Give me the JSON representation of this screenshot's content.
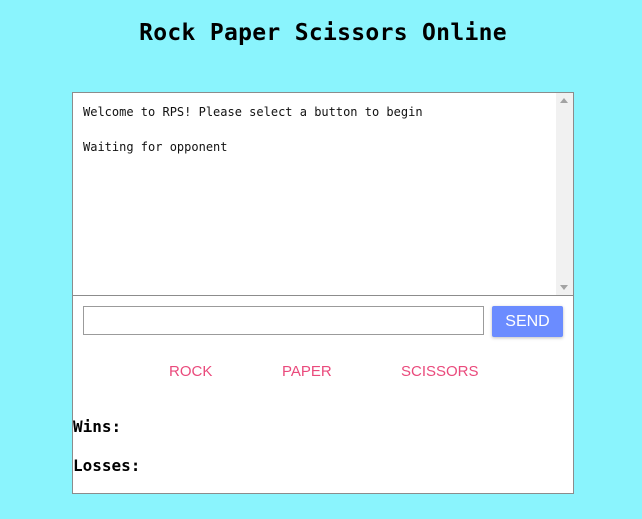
{
  "page": {
    "title": "Rock Paper Scissors Online",
    "background_color": "#8af4fd"
  },
  "chat": {
    "messages": [
      "Welcome to RPS! Please select a button to begin",
      "Waiting for opponent"
    ],
    "input_value": "",
    "send_label": "SEND",
    "send_color": "#6b8cff"
  },
  "choices": {
    "rock_label": "ROCK",
    "paper_label": "PAPER",
    "scissors_label": "SCISSORS",
    "label_color": "#ea4a7c"
  },
  "stats": {
    "wins_label": "Wins:",
    "losses_label": "Losses:"
  },
  "icons": {
    "scroll_up": "scroll-up-arrow-icon",
    "scroll_down": "scroll-down-arrow-icon"
  }
}
